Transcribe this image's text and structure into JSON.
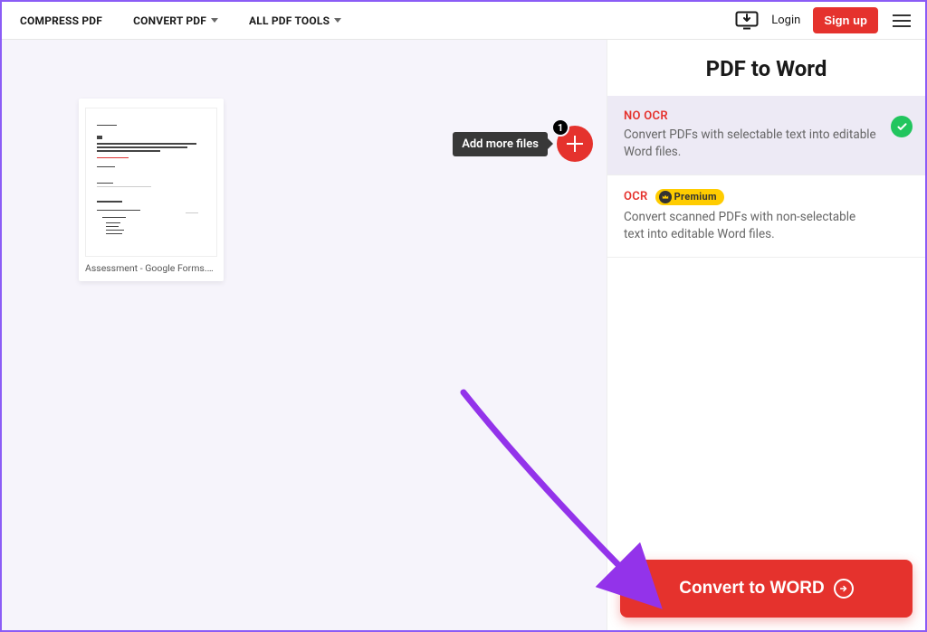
{
  "nav": {
    "compress": "COMPRESS PDF",
    "convert": "CONVERT PDF",
    "alltools": "ALL PDF TOOLS"
  },
  "auth": {
    "login": "Login",
    "signup": "Sign up"
  },
  "file": {
    "name": "Assessment - Google Forms.pdf"
  },
  "addmore": {
    "tooltip": "Add more files",
    "badge": "1"
  },
  "sidebar": {
    "title": "PDF to Word",
    "options": [
      {
        "heading": "NO OCR",
        "desc": "Convert PDFs with selectable text into editable Word files."
      },
      {
        "heading": "OCR",
        "premium": "Premium",
        "desc": "Convert scanned PDFs with non-selectable text into editable Word files."
      }
    ]
  },
  "cta": "Convert to WORD"
}
